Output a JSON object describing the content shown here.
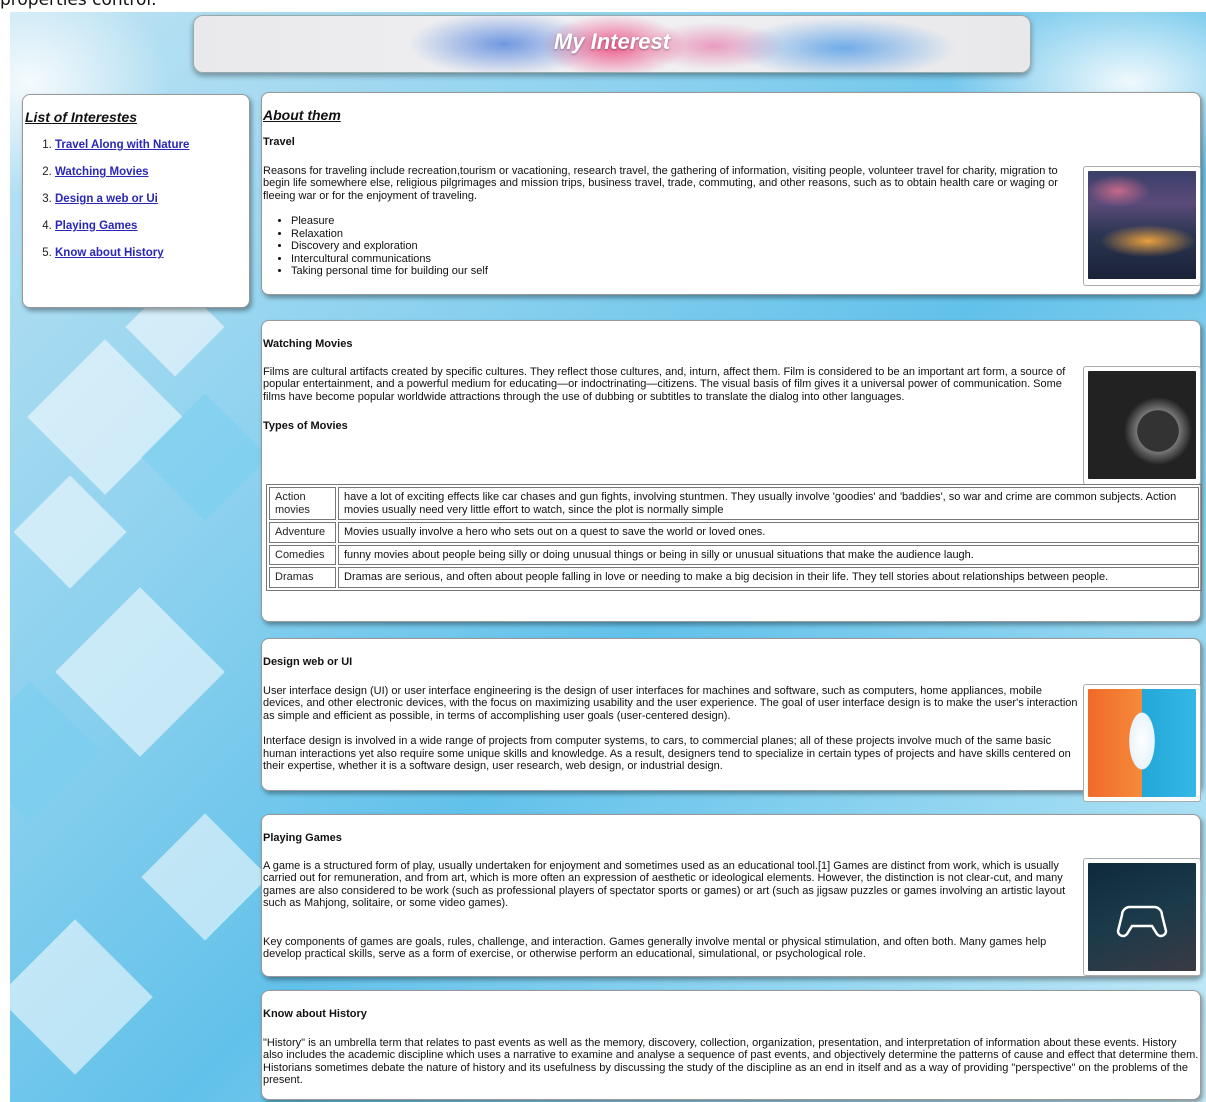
{
  "top_cut_text": "properties control.",
  "banner": {
    "title": "My Interest"
  },
  "sidebar": {
    "title": "List of Interestes",
    "items": [
      {
        "label": "Travel Along with Nature"
      },
      {
        "label": "Watching Movies"
      },
      {
        "label": "Design a web or Ui"
      },
      {
        "label": "Playing Games"
      },
      {
        "label": "Know about History"
      }
    ]
  },
  "about": {
    "heading": "About them",
    "travel": {
      "title": "Travel",
      "text": "Reasons for traveling include recreation,tourism or vacationing, research travel, the gathering of information, visiting people, volunteer travel for charity, migration to begin life somewhere else, religious pilgrimages and mission trips, business travel, trade, commuting, and other reasons, such as to obtain health care or waging or fleeing war or for the enjoyment of traveling.",
      "bullets": [
        "Pleasure",
        "Relaxation",
        "Discovery and exploration",
        "Intercultural communications",
        "Taking personal time for building our self"
      ]
    }
  },
  "movies": {
    "title": "Watching Movies",
    "text": "Films are cultural artifacts created by specific cultures. They reflect those cultures, and, inturn, affect them. Film is considered to be an important art form, a source of popular entertainment, and a powerful medium for educating—or indoctrinating—citizens. The visual basis of film gives it a universal power of communication. Some films have become popular worldwide attractions through the use of dubbing or subtitles to translate the dialog into other languages.",
    "types_title": "Types of Movies",
    "table": [
      {
        "name": "Action movies",
        "desc": "have a lot of exciting effects like car chases and gun fights, involving stuntmen. They usually involve 'goodies' and 'baddies', so war and crime are common subjects. Action movies usually need very little effort to watch, since the plot is normally simple"
      },
      {
        "name": "Adventure",
        "desc": "Movies usually involve a hero who sets out on a quest to save the world or loved ones."
      },
      {
        "name": "Comedies",
        "desc": "funny movies about people being silly or doing unusual things or being in silly or unusual situations that make the audience laugh."
      },
      {
        "name": "Dramas",
        "desc": "Dramas are serious, and often about people falling in love or needing to make a big decision in their life. They tell stories about relationships between people."
      }
    ]
  },
  "design": {
    "title": "Design web or UI",
    "p1": "User interface design (UI) or user interface engineering is the design of user interfaces for machines and software, such as computers, home appliances, mobile devices, and other electronic devices, with the focus on maximizing usability and the user experience. The goal of user interface design is to make the user's interaction as simple and efficient as possible, in terms of accomplishing user goals (user-centered design).",
    "p2": "Interface design is involved in a wide range of projects from computer systems, to cars, to commercial planes; all of these projects involve much of the same basic human interactions yet also require some unique skills and knowledge. As a result, designers tend to specialize in certain types of projects and have skills centered on their expertise, whether it is a software design, user research, web design, or industrial design."
  },
  "games": {
    "title": "Playing Games",
    "p1": "A game is a structured form of play, usually undertaken for enjoyment and sometimes used as an educational tool.[1] Games are distinct from work, which is usually carried out for remuneration, and from art, which is more often an expression of aesthetic or ideological elements. However, the distinction is not clear-cut, and many games are also considered to be work (such as professional players of spectator sports or games) or art (such as jigsaw puzzles or games involving an artistic layout such as Mahjong, solitaire, or some video games).",
    "p2": "Key components of games are goals, rules, challenge, and interaction. Games generally involve mental or physical stimulation, and often both. Many games help develop practical skills, serve as a form of exercise, or otherwise perform an educational, simulational, or psychological role."
  },
  "history": {
    "title": "Know about History",
    "text": "\"History\" is an umbrella term that relates to past events as well as the memory, discovery, collection, organization, presentation, and interpretation of information about these events. History also includes the academic discipline which uses a narrative to examine and analyse a sequence of past events, and objectively determine the patterns of cause and effect that determine them. Historians sometimes debate the nature of history and its usefulness by discussing the study of the discipline as an end in itself and as a way of providing \"perspective\" on the problems of the present."
  }
}
